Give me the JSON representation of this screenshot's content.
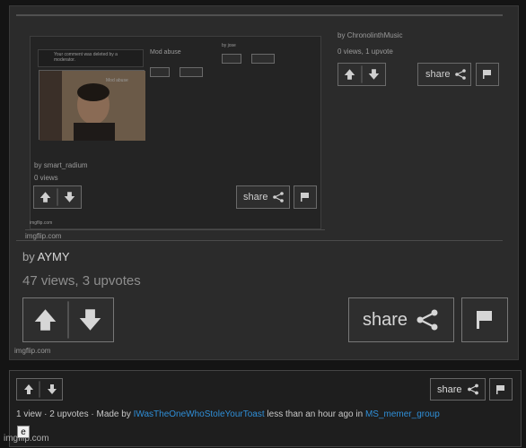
{
  "outer_post": {
    "author_prefix": "by",
    "author": "AYMY",
    "stats": "47 views, 3 upvotes",
    "share_label": "share",
    "watermark": "imgflip.com"
  },
  "right_post": {
    "author_prefix": "by",
    "author": "ChronolinthMusic",
    "stats": "0 views, 1 upvote",
    "share_label": "share"
  },
  "inner_post": {
    "author_prefix": "by",
    "author": "smart_radium",
    "stats": "0 views",
    "share_label": "share",
    "watermark": "imgflip.com",
    "tiny_notice": "Your comment was deleted by a moderator.",
    "tiny_title": "Mod abuse",
    "tiny_author": "by jose"
  },
  "panel": {
    "share_label": "share",
    "line_prefix": "1 view · 2 upvotes · Made by",
    "user": "IWasTheOneWhoStoleYourToast",
    "line_middle": "less than an hour ago in",
    "stream": "MS_memer_group",
    "watermark": "imgflip.com",
    "caption_box": "e"
  },
  "colors": {
    "link": "#2f8fd8",
    "background": "#141414",
    "meme_bg": "#2b2b2b"
  }
}
